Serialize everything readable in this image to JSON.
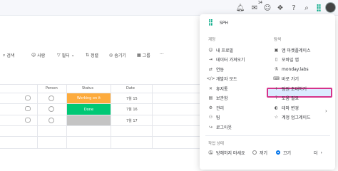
{
  "topbar": {
    "notification_count": "14"
  },
  "toolbar": {
    "search": "검색",
    "person": "사람",
    "filter": "필터",
    "sort": "정렬",
    "hide": "숨기기",
    "group": "그룹",
    "more": "···"
  },
  "table": {
    "headers": {
      "person": "Person",
      "status": "Status",
      "date": "Date"
    },
    "rows": [
      {
        "status": "Working on it",
        "status_color": "#fdab3d",
        "date": "7월 15"
      },
      {
        "status": "Done",
        "status_color": "#00c875",
        "date": "7월 16"
      },
      {
        "status": "",
        "status_color": "#c4c4c4",
        "date": "7월 17"
      }
    ]
  },
  "menu": {
    "account_name": "SPH",
    "account_section": "계정",
    "explore_section": "탐색",
    "left_items": [
      {
        "label": "내 프로필",
        "icon": "person-icon"
      },
      {
        "label": "데이터 가져오기",
        "icon": "import-icon"
      },
      {
        "label": "연동",
        "icon": "integration-icon"
      },
      {
        "label": "개발자 모드",
        "icon": "code-icon"
      },
      {
        "label": "휴지통",
        "icon": "trash-icon"
      },
      {
        "label": "보관함",
        "icon": "archive-icon"
      },
      {
        "label": "관리",
        "icon": "gear-icon"
      },
      {
        "label": "팀",
        "icon": "team-icon"
      },
      {
        "label": "로그아웃",
        "icon": "logout-icon"
      }
    ],
    "right_items": [
      {
        "label": "앱 마켓플레이스",
        "icon": "marketplace-icon"
      },
      {
        "label": "모바일 앱",
        "icon": "mobile-icon"
      },
      {
        "label": "monday.labs",
        "icon": "labs-icon"
      },
      {
        "label": "바로 가기",
        "icon": "shortcut-icon"
      },
      {
        "label": "팀원 초대하기",
        "icon": "plus-icon"
      },
      {
        "label": "도움 필요",
        "icon": "help-icon"
      },
      {
        "label": "테마 변경",
        "icon": "theme-icon"
      },
      {
        "label": "계정 업그레이드",
        "icon": "upgrade-icon"
      }
    ],
    "work_status_section": "작업 상태",
    "dnd_label": "방해하지 마세요",
    "off_label": "꺼기",
    "on_label": "끄기",
    "more_label": "더"
  }
}
